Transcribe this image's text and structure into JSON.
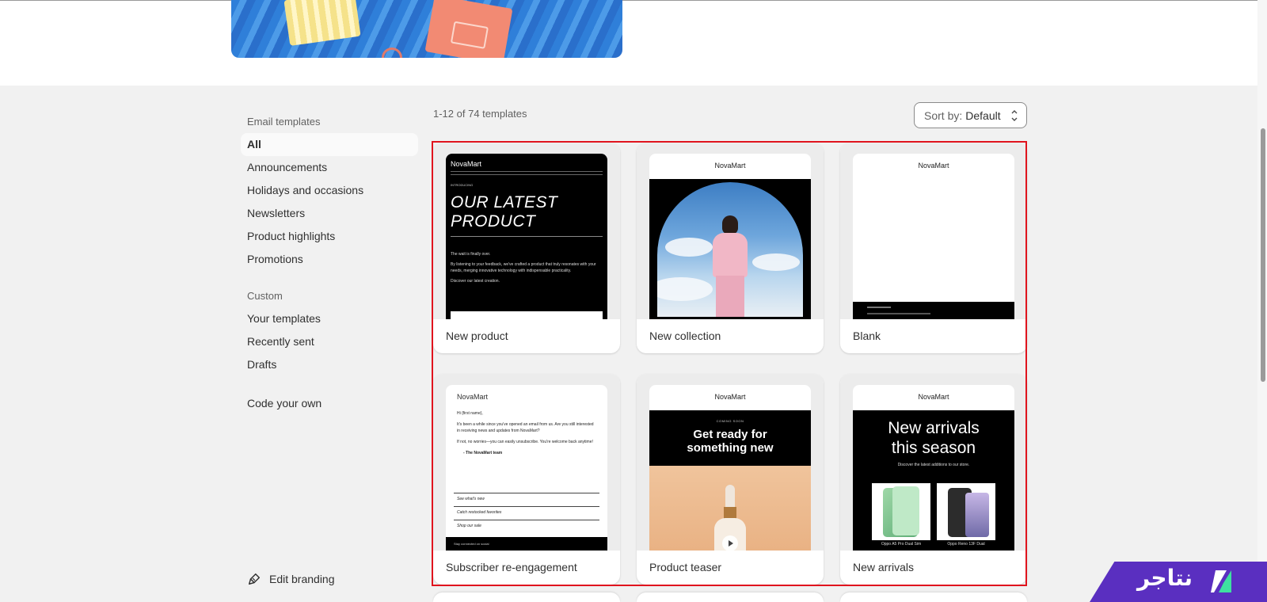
{
  "sidebar": {
    "heading_templates": "Email templates",
    "items": [
      {
        "label": "All"
      },
      {
        "label": "Announcements"
      },
      {
        "label": "Holidays and occasions"
      },
      {
        "label": "Newsletters"
      },
      {
        "label": "Product highlights"
      },
      {
        "label": "Promotions"
      }
    ],
    "heading_custom": "Custom",
    "custom_items": [
      {
        "label": "Your templates"
      },
      {
        "label": "Recently sent"
      },
      {
        "label": "Drafts"
      }
    ],
    "code_your_own": "Code your own",
    "edit_branding": "Edit branding"
  },
  "toolbar": {
    "count": "1-12 of 74 templates",
    "sort_label": "Sort by:",
    "sort_value": "Default"
  },
  "templates": [
    {
      "title": "New product",
      "brand": "NovaMart",
      "intro": "INTRODUCING",
      "headline_1": "OUR LATEST",
      "headline_2": "PRODUCT",
      "body_1": "The wait is finally over.",
      "body_2": "By listening to your feedback, we've crafted a product that truly resonates with your needs, merging innovative technology with indispensable practicality.",
      "body_3": "Discover our latest creation."
    },
    {
      "title": "New collection",
      "brand": "NovaMart"
    },
    {
      "title": "Blank",
      "brand": "NovaMart"
    },
    {
      "title": "Subscriber re-engagement",
      "brand": "NovaMart",
      "greeting": "Hi {first name},",
      "p1": "It's been a while since you've opened an email from us. Are you still interested in receiving news and updates from NovaMart?",
      "p2": "If not, no worries—you can easily unsubscribe. You're welcome back anytime!",
      "signoff": "- The NovaMart team",
      "links": [
        "See what's new",
        "Catch restocked favorites",
        "Shop our sale"
      ],
      "footer": "Stay connected on social"
    },
    {
      "title": "Product teaser",
      "brand": "NovaMart",
      "kicker": "COMING SOON",
      "headline_1": "Get ready for",
      "headline_2": "something new"
    },
    {
      "title": "New arrivals",
      "brand": "NovaMart",
      "headline_1": "New arrivals",
      "headline_2": "this season",
      "sub": "Discover the latest additions to our store.",
      "product_1": "Oppo A5 Pro Dual Sim",
      "product_2": "Oppo Reno 13F Dual"
    }
  ],
  "watermark": {
    "text": "نتاجر",
    "color": "#5a2fc0"
  },
  "colors": {
    "highlight_frame": "#e0141e"
  }
}
